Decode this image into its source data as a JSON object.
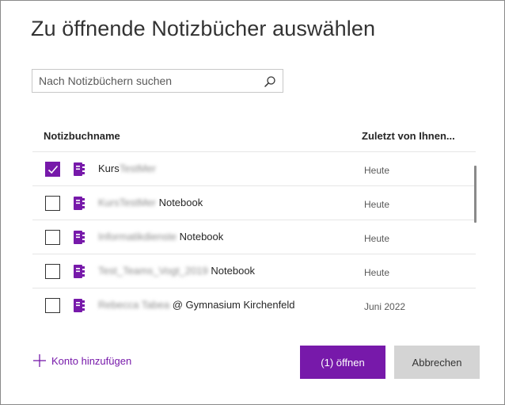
{
  "dialog": {
    "title": "Zu öffnende Notizbücher auswählen"
  },
  "search": {
    "placeholder": "Nach Notizbüchern suchen",
    "value": "",
    "icon": "search-icon"
  },
  "table": {
    "headers": {
      "name": "Notizbuchname",
      "date": "Zuletzt von Ihnen..."
    },
    "rows": [
      {
        "checked": true,
        "name_blurred": "KursTestMer",
        "name_visible": "",
        "date": "Heute"
      },
      {
        "checked": false,
        "name_blurred": "KursTestMer",
        "name_visible": " Notebook",
        "date": "Heute"
      },
      {
        "checked": false,
        "name_blurred": "Informatikdienste",
        "name_visible": " Notebook",
        "date": "Heute"
      },
      {
        "checked": false,
        "name_blurred": "Test_Teams_Vogt_2019",
        "name_visible": " Notebook",
        "date": "Heute"
      },
      {
        "checked": false,
        "name_blurred": "Rebecca Tabea",
        "name_visible": " @ Gymnasium Kirchenfeld",
        "date": "Juni 2022"
      }
    ]
  },
  "footer": {
    "add_account_label": "Konto hinzufügen",
    "open_label": "(1) öffnen",
    "cancel_label": "Abbrechen"
  },
  "colors": {
    "accent": "#7719aa",
    "cancel_bg": "#d4d4d4",
    "notebook_icon": "#7719aa"
  }
}
